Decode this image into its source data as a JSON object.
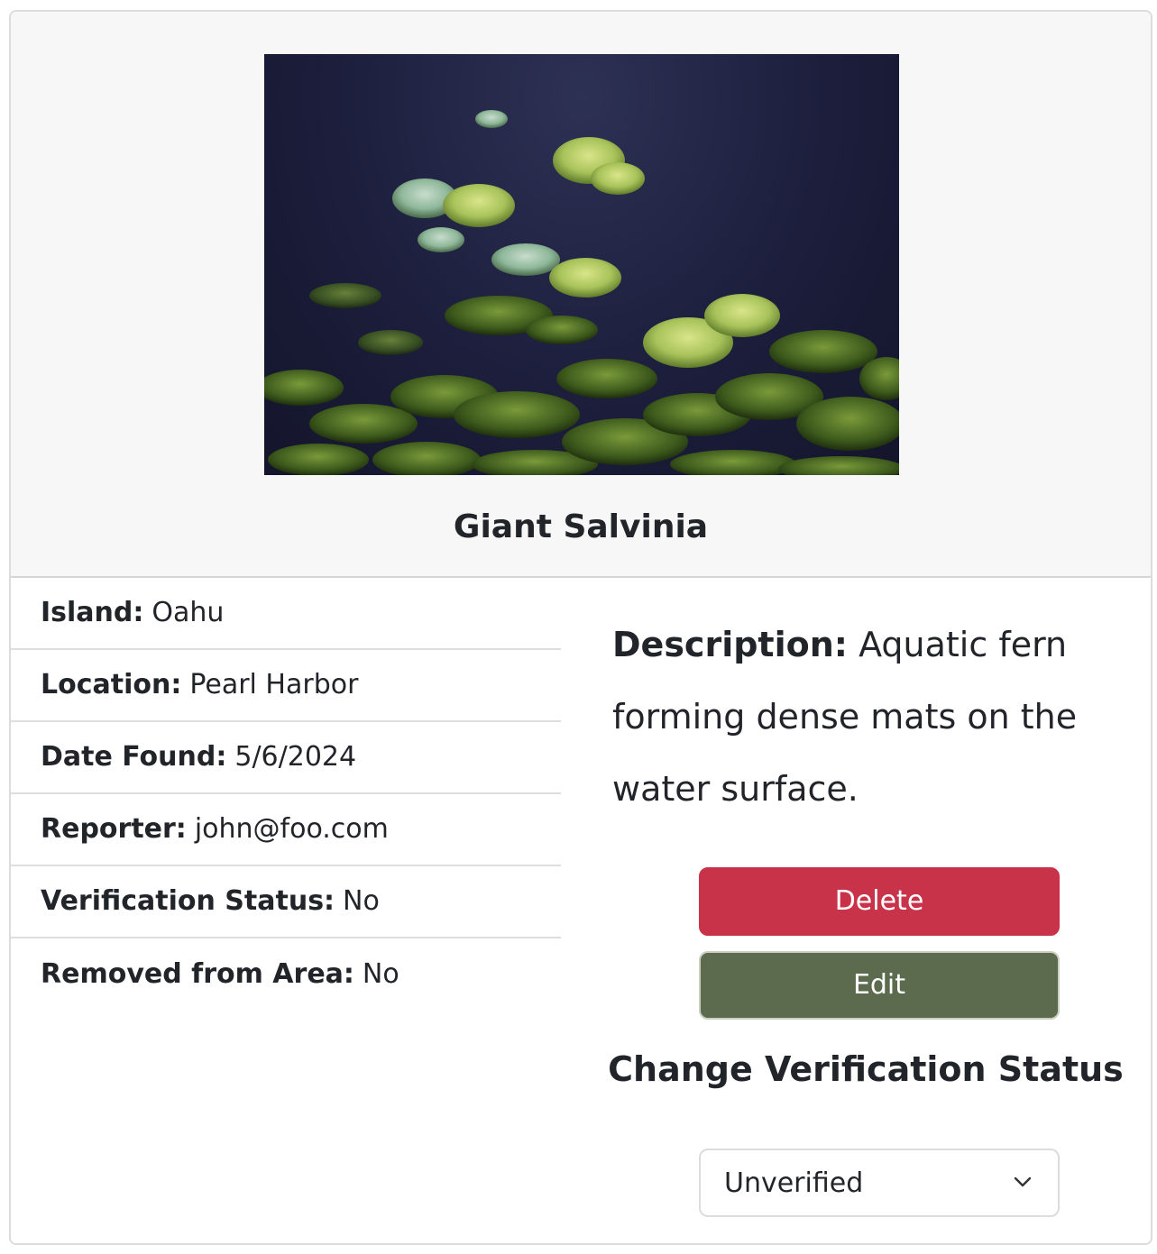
{
  "card": {
    "title": "Giant Salvinia",
    "image_alt": "Giant Salvinia floating on dark water"
  },
  "details": [
    {
      "label": "Island:",
      "value": "Oahu"
    },
    {
      "label": "Location:",
      "value": "Pearl Harbor"
    },
    {
      "label": "Date Found:",
      "value": "5/6/2024"
    },
    {
      "label": "Reporter:",
      "value": "john@foo.com"
    },
    {
      "label": "Verification Status:",
      "value": "No"
    },
    {
      "label": "Removed from Area:",
      "value": "No"
    }
  ],
  "description": {
    "label": "Description:",
    "text": "Aquatic fern forming dense mats on the water surface."
  },
  "actions": {
    "delete_label": "Delete",
    "edit_label": "Edit"
  },
  "verification": {
    "heading": "Change Verification Status",
    "selected": "Unverified"
  },
  "colors": {
    "delete": "#c9334a",
    "edit": "#5c6a4d",
    "header_bg": "#f7f7f7"
  }
}
